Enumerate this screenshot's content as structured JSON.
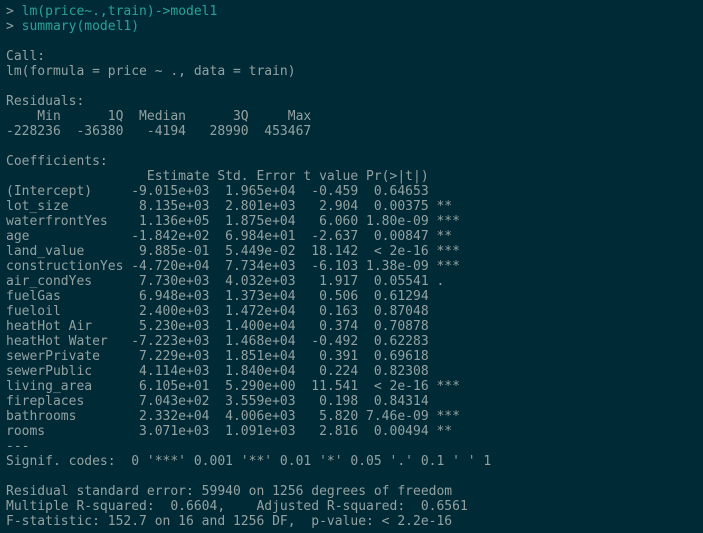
{
  "prompt_sym": "> ",
  "cmd1": "lm(price~.,train)->model1",
  "cmd2": "summary(model1)",
  "blank": "",
  "call_hdr": "Call:",
  "call_line": "lm(formula = price ~ ., data = train)",
  "res_hdr": "Residuals:",
  "res_names": "    Min      1Q  Median      3Q     Max ",
  "res_vals": "-228236  -36380   -4194   28990  453467 ",
  "coef_hdr": "Coefficients:",
  "coef_head": "                  Estimate Std. Error t value Pr(>|t|)    ",
  "c01": "(Intercept)     -9.015e+03  1.965e+04  -0.459  0.64653    ",
  "c02": "lot_size         8.135e+03  2.801e+03   2.904  0.00375 ** ",
  "c03": "waterfrontYes    1.136e+05  1.875e+04   6.060 1.80e-09 ***",
  "c04": "age             -1.842e+02  6.984e+01  -2.637  0.00847 ** ",
  "c05": "land_value       9.885e-01  5.449e-02  18.142  < 2e-16 ***",
  "c06": "constructionYes -4.720e+04  7.734e+03  -6.103 1.38e-09 ***",
  "c07": "air_condYes      7.730e+03  4.032e+03   1.917  0.05541 .  ",
  "c08": "fuelGas          6.948e+03  1.373e+04   0.506  0.61294    ",
  "c09": "fueloil          2.400e+03  1.472e+04   0.163  0.87048    ",
  "c10": "heatHot Air      5.230e+03  1.400e+04   0.374  0.70878    ",
  "c11": "heatHot Water   -7.223e+03  1.468e+04  -0.492  0.62283    ",
  "c12": "sewerPrivate     7.229e+03  1.851e+04   0.391  0.69618    ",
  "c13": "sewerPublic      4.114e+03  1.840e+04   0.224  0.82308    ",
  "c14": "living_area      6.105e+01  5.290e+00  11.541  < 2e-16 ***",
  "c15": "fireplaces       7.043e+02  3.559e+03   0.198  0.84314    ",
  "c16": "bathrooms        2.332e+04  4.006e+03   5.820 7.46e-09 ***",
  "c17": "rooms            3.071e+03  1.091e+03   2.816  0.00494 ** ",
  "sep": "---",
  "signif": "Signif. codes:  0 '***' 0.001 '**' 0.01 '*' 0.05 '.' 0.1 ' ' 1",
  "rse": "Residual standard error: 59940 on 1256 degrees of freedom",
  "r2": "Multiple R-squared:  0.6604,\tAdjusted R-squared:  0.6561 ",
  "fstat": "F-statistic: 152.7 on 16 and 1256 DF,  p-value: < 2.2e-16",
  "chart_data": {
    "type": "table",
    "title": "lm summary: price ~ . (train)",
    "residuals": {
      "Min": -228236,
      "1Q": -36380,
      "Median": -4194,
      "3Q": 28990,
      "Max": 453467
    },
    "coefficients": [
      {
        "term": "(Intercept)",
        "estimate": -9015.0,
        "std_error": 19650.0,
        "t_value": -0.459,
        "p_value": 0.64653,
        "signif": ""
      },
      {
        "term": "lot_size",
        "estimate": 8135.0,
        "std_error": 2801.0,
        "t_value": 2.904,
        "p_value": 0.00375,
        "signif": "**"
      },
      {
        "term": "waterfrontYes",
        "estimate": 113600.0,
        "std_error": 18750.0,
        "t_value": 6.06,
        "p_value": 1.8e-09,
        "signif": "***"
      },
      {
        "term": "age",
        "estimate": -184.2,
        "std_error": 69.84,
        "t_value": -2.637,
        "p_value": 0.00847,
        "signif": "**"
      },
      {
        "term": "land_value",
        "estimate": 0.9885,
        "std_error": 0.05449,
        "t_value": 18.142,
        "p_value": 2e-16,
        "signif": "***"
      },
      {
        "term": "constructionYes",
        "estimate": -47200.0,
        "std_error": 7734.0,
        "t_value": -6.103,
        "p_value": 1.38e-09,
        "signif": "***"
      },
      {
        "term": "air_condYes",
        "estimate": 7730.0,
        "std_error": 4032.0,
        "t_value": 1.917,
        "p_value": 0.05541,
        "signif": "."
      },
      {
        "term": "fuelGas",
        "estimate": 6948.0,
        "std_error": 13730.0,
        "t_value": 0.506,
        "p_value": 0.61294,
        "signif": ""
      },
      {
        "term": "fueloil",
        "estimate": 2400.0,
        "std_error": 14720.0,
        "t_value": 0.163,
        "p_value": 0.87048,
        "signif": ""
      },
      {
        "term": "heatHot Air",
        "estimate": 5230.0,
        "std_error": 14000.0,
        "t_value": 0.374,
        "p_value": 0.70878,
        "signif": ""
      },
      {
        "term": "heatHot Water",
        "estimate": -7223.0,
        "std_error": 14680.0,
        "t_value": -0.492,
        "p_value": 0.62283,
        "signif": ""
      },
      {
        "term": "sewerPrivate",
        "estimate": 7229.0,
        "std_error": 18510.0,
        "t_value": 0.391,
        "p_value": 0.69618,
        "signif": ""
      },
      {
        "term": "sewerPublic",
        "estimate": 4114.0,
        "std_error": 18400.0,
        "t_value": 0.224,
        "p_value": 0.82308,
        "signif": ""
      },
      {
        "term": "living_area",
        "estimate": 61.05,
        "std_error": 5.29,
        "t_value": 11.541,
        "p_value": 2e-16,
        "signif": "***"
      },
      {
        "term": "fireplaces",
        "estimate": 704.3,
        "std_error": 3559.0,
        "t_value": 0.198,
        "p_value": 0.84314,
        "signif": ""
      },
      {
        "term": "bathrooms",
        "estimate": 23320.0,
        "std_error": 4006.0,
        "t_value": 5.82,
        "p_value": 7.46e-09,
        "signif": "***"
      },
      {
        "term": "rooms",
        "estimate": 3071.0,
        "std_error": 1091.0,
        "t_value": 2.816,
        "p_value": 0.00494,
        "signif": "**"
      }
    ],
    "residual_std_error": 59940,
    "df_residual": 1256,
    "r_squared": 0.6604,
    "adj_r_squared": 0.6561,
    "f_statistic": 152.7,
    "f_df1": 16,
    "f_df2": 1256,
    "f_p_value": 2.2e-16
  }
}
